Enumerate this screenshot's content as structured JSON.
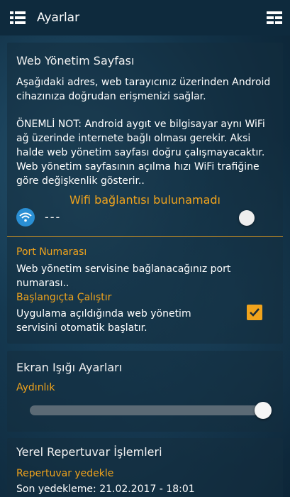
{
  "appbar": {
    "title": "Ayarlar",
    "menu_icon": "list-menu-icon",
    "right_icon": "grid-menu-icon"
  },
  "web_management": {
    "title": "Web Yönetim Sayfası",
    "description": "Aşağıdaki adres, web tarayıcınız üzerinden Android cihazınıza doğrudan erişmenizi sağlar.",
    "important_note": "ÖNEMLİ NOT: Android aygıt ve bilgisayar aynı WiFi ağ üzerinde internete bağlı olması gerekir. Aksi halde web yönetim sayfası doğru çalışmayacaktır. Web yönetim sayfasının açılma hızı WiFi trafiğine göre değişkenlik gösterir..",
    "wifi_status": "Wifi bağlantısı bulunamadı",
    "address_value": "---",
    "switch_on": false
  },
  "port": {
    "title": "Port Numarası",
    "description": "Web yönetim servisine bağlanacağınız port numarası.."
  },
  "autostart": {
    "title": "Başlangıçta Çalıştır",
    "description": "Uygulama açıldığında web yönetim servisini otomatik başlatır.",
    "checked": true
  },
  "screen_light": {
    "title": "Ekran Işığı Ayarları",
    "brightness_label": "Aydınlık",
    "brightness_value": 1.0
  },
  "local_repo": {
    "title": "Yerel Repertuvar İşlemleri",
    "backup_label": "Repertuvar yedekle",
    "last_backup": "Son yedekleme: 21.02.2017 - 18:01"
  },
  "colors": {
    "accent": "#f0a31c",
    "appbar": "#0e2a3d",
    "wifi_icon": "#2a8fd4"
  }
}
